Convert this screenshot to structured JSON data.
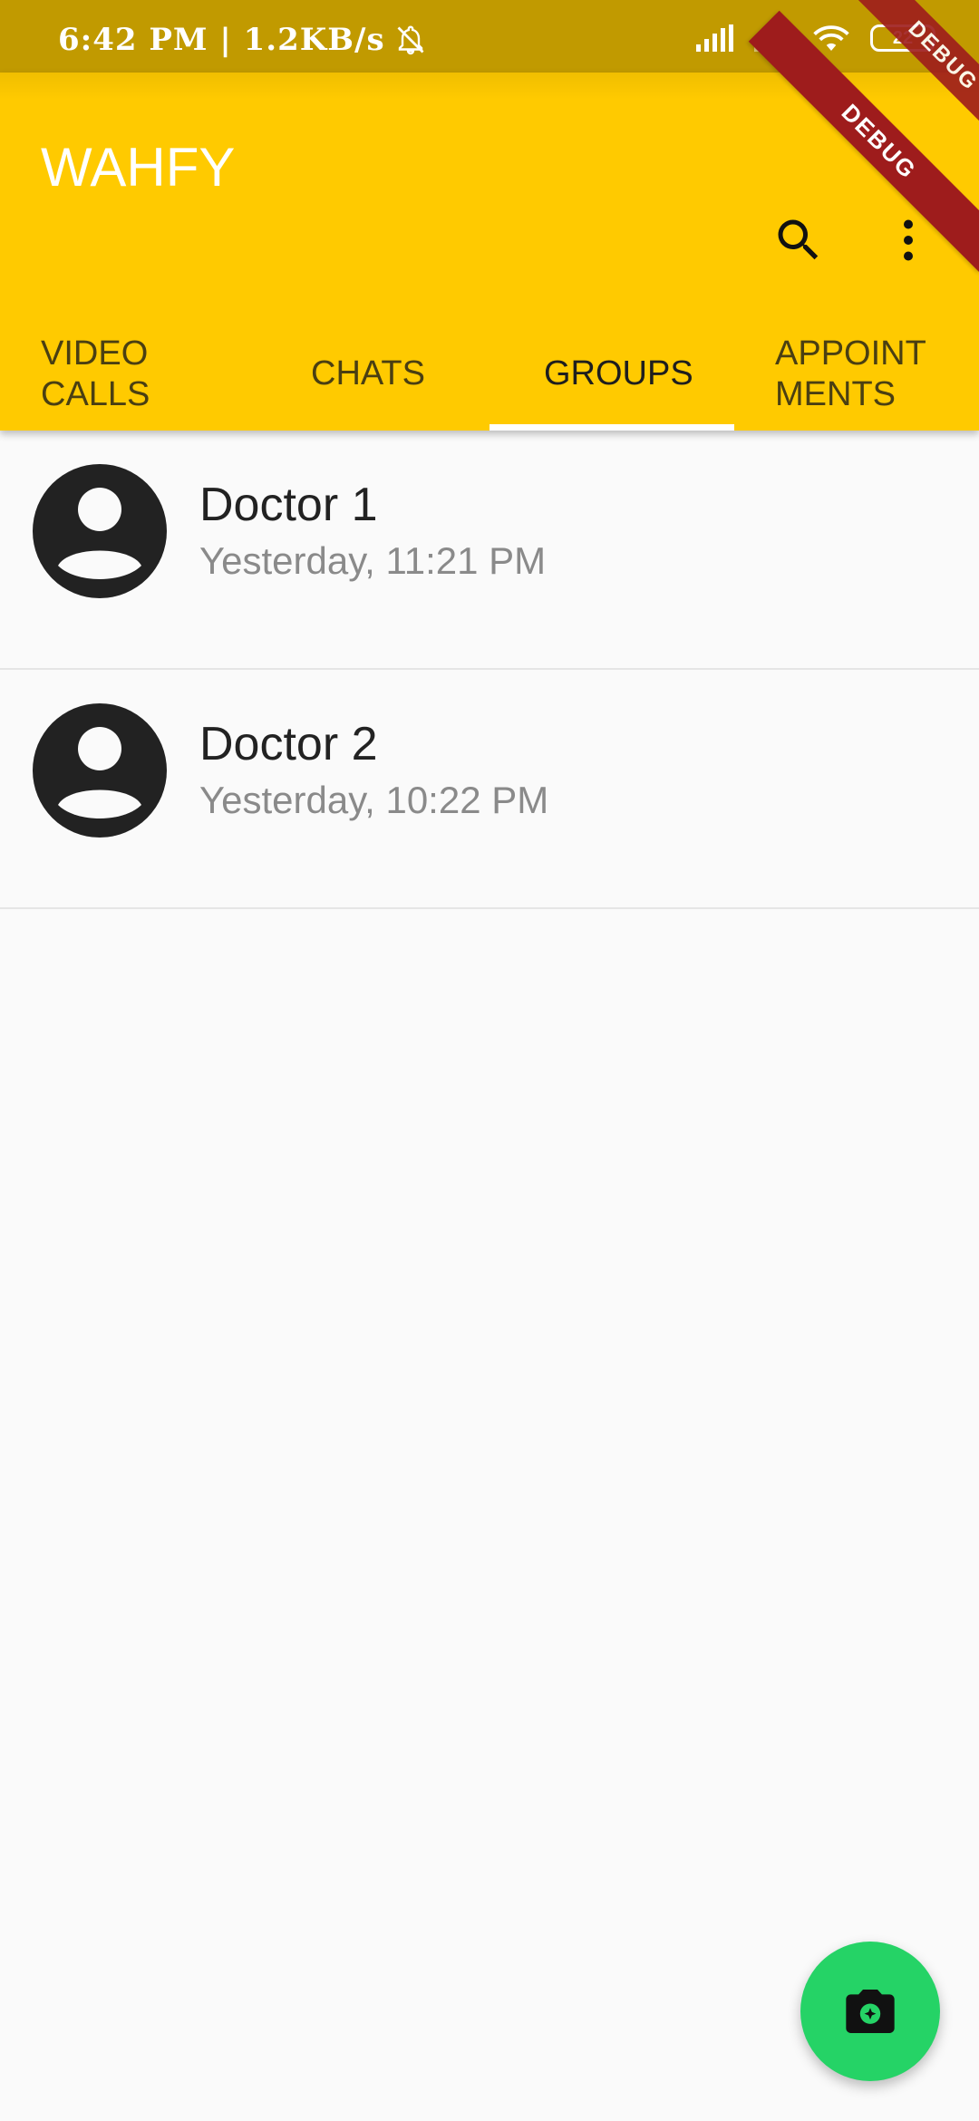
{
  "status_bar": {
    "time_and_speed": "6:42 PM | 1.2KB/s",
    "battery": "22",
    "icons": [
      "bell-off-icon",
      "signal-icon",
      "signal-no-service-icon",
      "wifi-icon",
      "battery-icon"
    ]
  },
  "app_bar": {
    "title": "WAHFY",
    "actions": [
      "search-icon",
      "more-vert-icon"
    ]
  },
  "tabs": [
    {
      "label": "VIDEO\nCALLS",
      "active": false
    },
    {
      "label": "CHATS",
      "active": false
    },
    {
      "label": "GROUPS",
      "active": true
    },
    {
      "label": "APPOINT\nMENTS",
      "active": false
    }
  ],
  "groups": [
    {
      "name": "Doctor 1",
      "time": "Yesterday, 11:21 PM"
    },
    {
      "name": "Doctor 2",
      "time": "Yesterday, 10:22 PM"
    }
  ],
  "fab": {
    "icon": "camera-icon"
  },
  "debug_banner": {
    "label": "DEBUG",
    "label_top": "DEBUG"
  },
  "colors": {
    "app_bar": "#FFCA00",
    "status_bar": "#C19A00",
    "fab": "#25D366",
    "debug": "#9E1C1C"
  }
}
